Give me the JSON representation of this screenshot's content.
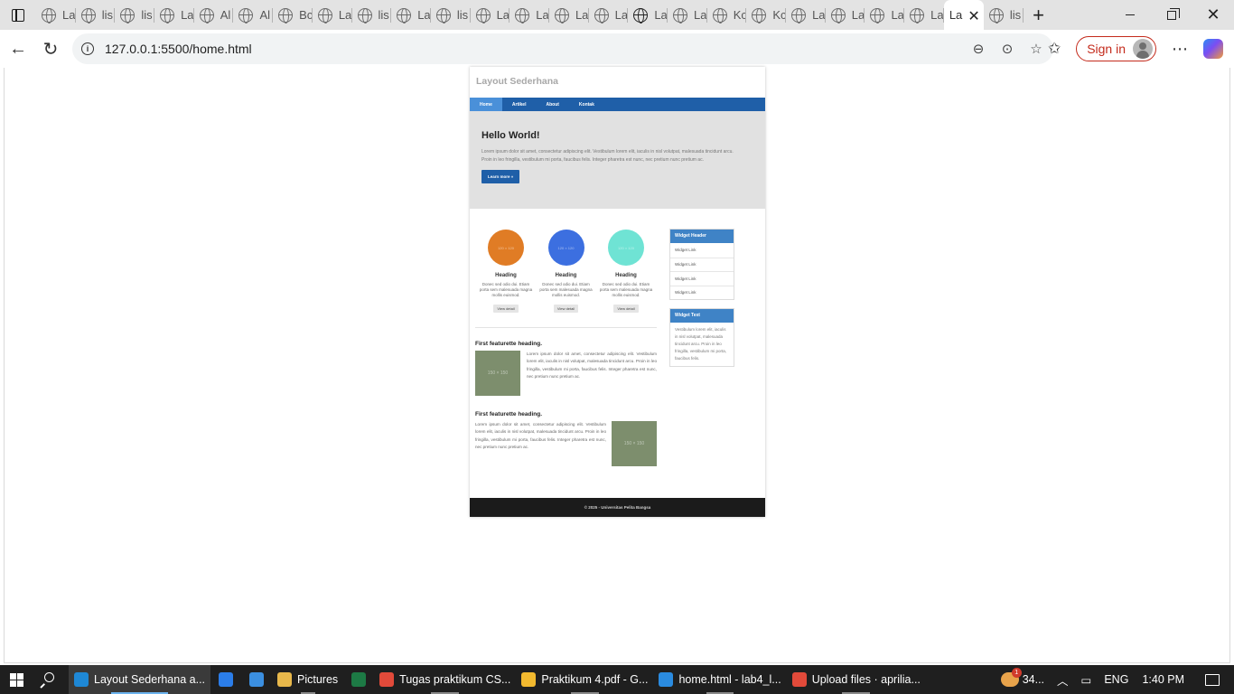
{
  "browser": {
    "tabs": [
      {
        "label": "La"
      },
      {
        "label": "lis"
      },
      {
        "label": "lis"
      },
      {
        "label": "La"
      },
      {
        "label": "Al"
      },
      {
        "label": "Al"
      },
      {
        "label": "Bc"
      },
      {
        "label": "La"
      },
      {
        "label": "lis"
      },
      {
        "label": "La"
      },
      {
        "label": "lis"
      },
      {
        "label": "La"
      },
      {
        "label": "La"
      },
      {
        "label": "La"
      },
      {
        "label": "La"
      },
      {
        "label": "La"
      },
      {
        "label": "La"
      },
      {
        "label": "Kc"
      },
      {
        "label": "Kc"
      },
      {
        "label": "La"
      },
      {
        "label": "La"
      },
      {
        "label": "La"
      },
      {
        "label": "La"
      }
    ],
    "active_tab_label": "La",
    "trailing_tab_label": "lis",
    "url": "127.0.0.1:5500/home.html",
    "signin_label": "Sign in"
  },
  "site": {
    "title": "Layout Sederhana",
    "nav": [
      {
        "label": "Home"
      },
      {
        "label": "Artikel"
      },
      {
        "label": "About"
      },
      {
        "label": "Kontak"
      }
    ],
    "hero": {
      "title": "Hello World!",
      "text": "Lorem ipsum dolor sit amet, consectetur adipiscing elit. Vestibulum lorem elit, iaculis in nisl volutpat, malesuada tincidunt arcu. Proin in leo fringilla, vestibulum mi porta, faucibus felis. Integer pharetra est nunc, nec pretium nunc pretium ac.",
      "button": "Learn more »"
    },
    "cards": [
      {
        "img_label": "120 × 120",
        "heading": "Heading",
        "text": "Donec sed odio dui. Etiam porta sem malesuada magna mollis euismod.",
        "button": "View detail",
        "color": "#e07c25"
      },
      {
        "img_label": "120 × 120",
        "heading": "Heading",
        "text": "Donec sed odio dui. Etiam porta sem malesuada magna mollis euismod.",
        "button": "View detail",
        "color": "#3c6fe0"
      },
      {
        "img_label": "120 × 120",
        "heading": "Heading",
        "text": "Donec sed odio dui. Etiam porta sem malesuada magna mollis euismod.",
        "button": "View detail",
        "color": "#6fe3d4"
      }
    ],
    "featurettes": [
      {
        "heading": "First featurette heading.",
        "img_label": "150 × 150",
        "text": "Lorem ipsum dolor sit amet, consectetur adipiscing elit. Vestibulum lorem elit, iaculis in nisl volutpat, malesuada tincidunt arcu. Proin in leo fringilla, vestibulum mi porta, faucibus felis. Integer pharetra est nunc, nec pretium nunc pretium ac."
      },
      {
        "heading": "First featurette heading.",
        "img_label": "150 × 150",
        "text": "Lorem ipsum dolor sit amet, consectetur adipiscing elit. Vestibulum lorem elit, iaculis in nisl volutpat, malesuada tincidunt arcu. Proin in leo fringilla, vestibulum mi porta, faucibus felis. Integer pharetra est nunc, nec pretium nunc pretium ac."
      }
    ],
    "widget_links": {
      "header": "Widget Header",
      "links": [
        {
          "label": "Widget Link"
        },
        {
          "label": "Widget Link"
        },
        {
          "label": "Widget Link"
        },
        {
          "label": "Widget Link"
        }
      ]
    },
    "widget_text": {
      "header": "Widget Text",
      "text": "Vestibulum lorem elit, iaculis in nisl volutpat, malesuada tincidunt arcu. Proin in leo fringilla, vestibulum mi porta, faucibus felis."
    },
    "footer": "© 2025 - Universitas Pelita Bangsa"
  },
  "taskbar": {
    "apps": [
      {
        "label": "Layout Sederhana a...",
        "icon": "edge-icon",
        "color": "#1e88d6",
        "state": "active"
      },
      {
        "label": "",
        "icon": "mail-icon",
        "color": "#2b7de9",
        "state": "none"
      },
      {
        "label": "",
        "icon": "store-icon",
        "color": "#3b8fe0",
        "state": "none"
      },
      {
        "label": "Pictures",
        "icon": "folder-icon",
        "color": "#e8b84b",
        "state": "open"
      },
      {
        "label": "",
        "icon": "excel-icon",
        "color": "#1d7a45",
        "state": "none"
      },
      {
        "label": "Tugas praktikum CS...",
        "icon": "chrome-icon",
        "color": "#e24a3a",
        "state": "open"
      },
      {
        "label": "Praktikum 4.pdf - G...",
        "icon": "drive-icon",
        "color": "#f2b92f",
        "state": "open"
      },
      {
        "label": "home.html - lab4_l...",
        "icon": "vscode-icon",
        "color": "#2a8be0",
        "state": "open"
      },
      {
        "label": "Upload files · aprilia...",
        "icon": "chrome-icon",
        "color": "#e24a3a",
        "state": "open"
      }
    ],
    "weather": "34...",
    "weather_badge": "1",
    "language": "ENG",
    "time": "1:40 PM"
  }
}
